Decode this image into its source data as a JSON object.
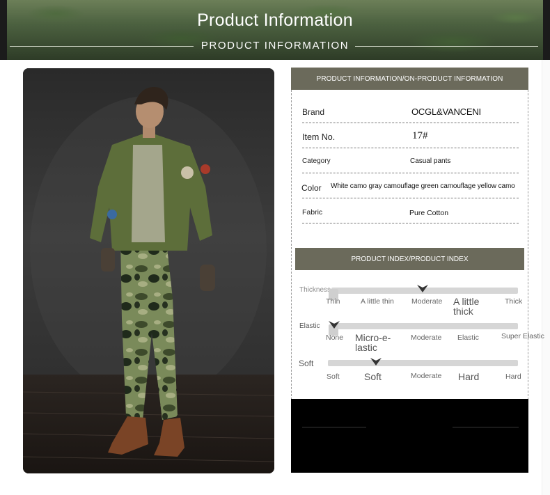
{
  "header": {
    "title": "Product Information",
    "subtitle": "PRODUCT INFORMATION"
  },
  "info": {
    "heading": "PRODUCT INFORMATION/ON-PRODUCT INFORMATION",
    "rows": [
      {
        "label": "Brand",
        "value": "OCGL&VANCENI"
      },
      {
        "label": "Item No.",
        "value": "17#"
      },
      {
        "label": "Category",
        "value": "Casual pants"
      },
      {
        "label": "Color",
        "value": "White camo gray camouflage green camouflage yellow camo"
      },
      {
        "label": "Fabric",
        "value": "Pure Cotton"
      }
    ]
  },
  "index": {
    "heading": "PRODUCT INDEX/PRODUCT INDEX",
    "scales": [
      {
        "name": "Thickness",
        "options": [
          "Thin",
          "A little thin",
          "Moderate",
          "A little thick",
          "Thick"
        ],
        "selected": 2
      },
      {
        "name": "Elastic",
        "options": [
          "None",
          "Micro-e-lastic",
          "Moderate",
          "Elastic",
          "Super Elastic"
        ],
        "selected": 0
      },
      {
        "name": "Soft",
        "options": [
          "Soft",
          "Soft",
          "Moderate",
          "Hard",
          "Hard"
        ],
        "selected": 1
      }
    ]
  },
  "colors": {
    "accent_bar": "#6b6a5b",
    "scale_track": "#d6d6d6"
  }
}
